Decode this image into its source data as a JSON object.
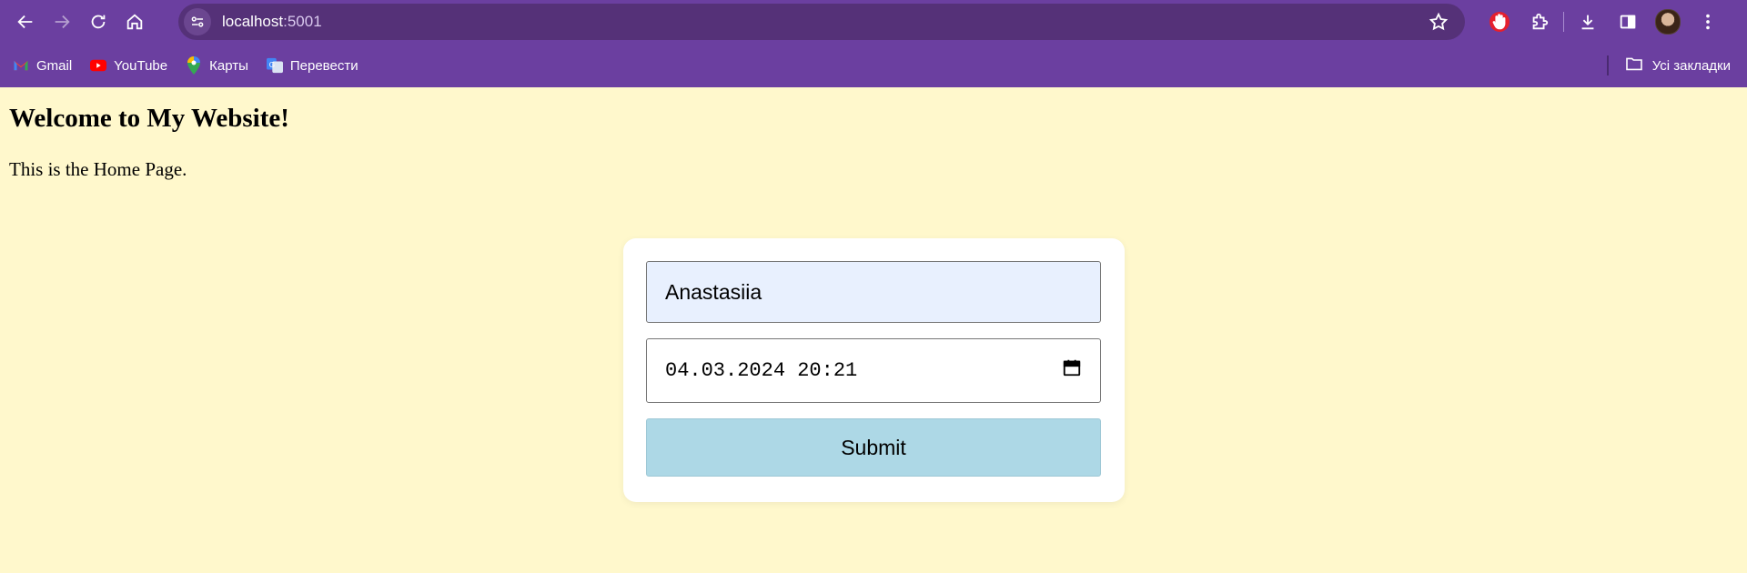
{
  "browser": {
    "url_host": "localhost",
    "url_port": ":5001",
    "bookmarks": [
      {
        "label": "Gmail",
        "icon": "gmail-icon"
      },
      {
        "label": "YouTube",
        "icon": "youtube-icon"
      },
      {
        "label": "Карты",
        "icon": "maps-icon"
      },
      {
        "label": "Перевести",
        "icon": "translate-icon"
      }
    ],
    "all_bookmarks_label": "Усі закладки"
  },
  "page": {
    "heading": "Welcome to My Website!",
    "subtitle": "This is the Home Page."
  },
  "form": {
    "name_value": "Anastasiia",
    "datetime_value": "04.03.2024 20:21",
    "submit_label": "Submit"
  },
  "colors": {
    "chrome": "#6b3fa0",
    "page_background": "#fff8cc",
    "submit_background": "#add8e6",
    "autofill_background": "#e8f0fe"
  }
}
